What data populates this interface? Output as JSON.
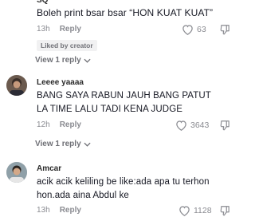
{
  "comments": [
    {
      "username": "SQ",
      "text": "Boleh print bsar bsar “HON KUAT KUAT”",
      "time": "13h",
      "reply_label": "Reply",
      "badge": "Liked by creator",
      "likes": "63",
      "view_replies": "View 1 reply"
    },
    {
      "username": "Leeee yaaaa",
      "text_line1": "BANG SAYA RABUN JAUH BANG PATUT",
      "text_line2": "LA TIME LALU TADI KENA JUDGE",
      "time": "12h",
      "reply_label": "Reply",
      "likes": "3643",
      "view_replies": "View 1 reply"
    },
    {
      "username": "Amcar",
      "text_line1": "acik acik keliling be like:ada apa tu terhon",
      "text_line2": "hon.ada aina Abdul ke",
      "time": "13h",
      "reply_label": "Reply",
      "likes": "1128"
    }
  ],
  "icons": {
    "like": "heart-outline-icon",
    "dislike": "thumbs-down-outline-icon",
    "expand": "chevron-down-icon"
  }
}
